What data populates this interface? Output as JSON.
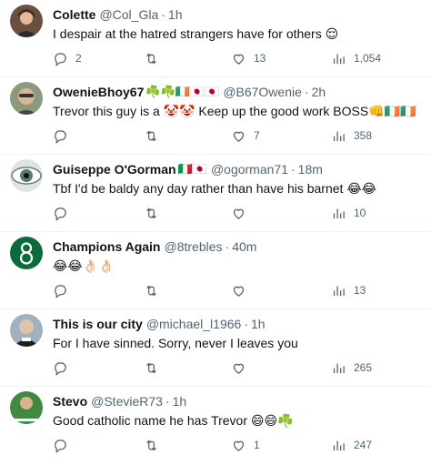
{
  "tweets": [
    {
      "name": "Colette",
      "flags": "",
      "handle": "@Col_Gla",
      "time": "1h",
      "text": "I despair at the hatred strangers have for others 😌",
      "replies": "2",
      "retweets": "",
      "likes": "13",
      "views": "1,054",
      "avatar_color": "#6b4f3f"
    },
    {
      "name": "OwenieBhoy67",
      "flags": "☘️☘️🇮🇪🇯🇵🇯🇵",
      "handle": "@B67Owenie",
      "time": "2h",
      "text": "Trevor this guy is a 🤡🤡 Keep up the good work BOSS👊🇮🇪🇮🇪",
      "replies": "",
      "retweets": "",
      "likes": "7",
      "views": "358",
      "avatar_color": "#8a9a7a"
    },
    {
      "name": "Guiseppe O'Gorman",
      "flags": "🇮🇹🇯🇵",
      "handle": "@ogorman71",
      "time": "18m",
      "text": "Tbf I'd be baldy any day rather than have his barnet 😂😂",
      "replies": "",
      "retweets": "",
      "likes": "",
      "views": "10",
      "avatar_color": "#5a7a6a"
    },
    {
      "name": "Champions Again",
      "flags": "",
      "handle": "@8trebles",
      "time": "40m",
      "text": "😂😂👌🏻👌🏻",
      "replies": "",
      "retweets": "",
      "likes": "",
      "views": "13",
      "avatar_color": "#0b6b3a"
    },
    {
      "name": "This is our city",
      "flags": "",
      "handle": "@michael_l1966",
      "time": "1h",
      "text": "For I have sinned. Sorry, never I leaves you",
      "replies": "",
      "retweets": "",
      "likes": "",
      "views": "265",
      "avatar_color": "#7f8c99"
    },
    {
      "name": "Stevo",
      "flags": "",
      "handle": "@StevieR73",
      "time": "1h",
      "text": "Good catholic name  he has Trevor 😄😄☘️",
      "replies": "",
      "retweets": "",
      "likes": "1",
      "views": "247",
      "avatar_color": "#3f8a3f"
    }
  ],
  "separator": "·",
  "icons": {
    "reply": "reply-icon",
    "retweet": "retweet-icon",
    "like": "heart-icon",
    "views": "views-chart-icon"
  }
}
